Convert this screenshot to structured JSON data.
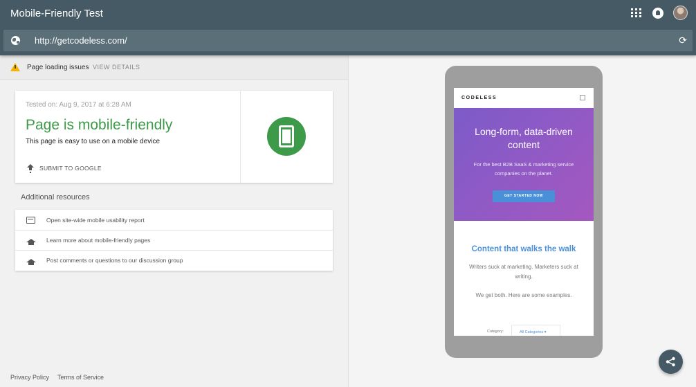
{
  "app": {
    "title": "Mobile-Friendly Test"
  },
  "url": {
    "value": "http://getcodeless.com/"
  },
  "issues": {
    "text": "Page loading issues",
    "link": "VIEW DETAILS"
  },
  "result": {
    "tested_on": "Tested on: Aug 9, 2017 at 6:28 AM",
    "verdict": "Page is mobile-friendly",
    "subtitle": "This page is easy to use on a mobile device",
    "submit_label": "SUBMIT TO GOOGLE"
  },
  "resources": {
    "title": "Additional resources",
    "items": [
      {
        "label": "Open site-wide mobile usability report",
        "icon": "report-icon"
      },
      {
        "label": "Learn more about mobile-friendly pages",
        "icon": "graduation-cap-icon"
      },
      {
        "label": "Post comments or questions to our discussion group",
        "icon": "graduation-cap-icon"
      }
    ]
  },
  "footer": {
    "privacy": "Privacy Policy",
    "terms": "Terms of Service"
  },
  "preview": {
    "logo": "CODELESS",
    "hero_title": "Long-form, data-driven content",
    "hero_subtitle": "For the best B2B SaaS & marketing service companies on the planet.",
    "hero_button": "GET STARTED NOW",
    "section_title": "Content that walks the walk",
    "section_text": "Writers suck at marketing. Marketers suck at writing.",
    "section_text2": "We get both. Here are some examples.",
    "category_label": "Category:",
    "category_value": "All Categories ▾"
  },
  "colors": {
    "appbar": "#455a64",
    "success": "#3c9a48",
    "warning": "#f4b400",
    "hero_start": "#7c5bc9",
    "hero_end": "#a558c0",
    "accent": "#4a90d9"
  }
}
